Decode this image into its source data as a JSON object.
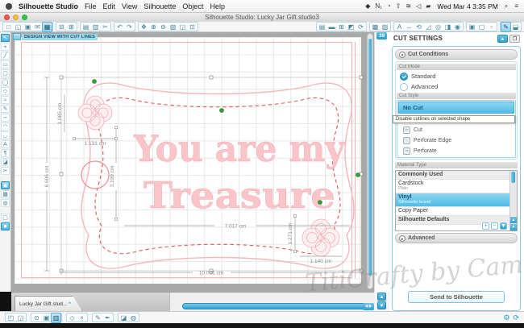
{
  "menubar": {
    "app": "Silhouette Studio",
    "items": [
      {
        "name": "menu-file",
        "label": "File"
      },
      {
        "name": "menu-edit",
        "label": "Edit"
      },
      {
        "name": "menu-view",
        "label": "View"
      },
      {
        "name": "menu-silhouette",
        "label": "Silhouette"
      },
      {
        "name": "menu-object",
        "label": "Object"
      },
      {
        "name": "menu-help",
        "label": "Help"
      }
    ],
    "status_icons": [
      {
        "name": "dropbox-icon",
        "glyph": "◆"
      },
      {
        "name": "notification-icon",
        "glyph": "N₁"
      },
      {
        "name": "progress-icon",
        "glyph": "◔"
      },
      {
        "name": "update-icon",
        "glyph": "⇧"
      },
      {
        "name": "wifi-icon",
        "glyph": "≋"
      },
      {
        "name": "volume-icon",
        "glyph": "◁"
      },
      {
        "name": "battery-icon",
        "glyph": "▰"
      }
    ],
    "clock": "Wed Mar 4 3:35 PM",
    "search_glyph": "⌕",
    "spotlight_glyph": "≡"
  },
  "titlebar": {
    "title": "Silhouette Studio: Lucky Jar Gift.studio3"
  },
  "toolbar_top": {
    "file_group": [
      {
        "name": "new-document-icon",
        "glyph": "□"
      },
      {
        "name": "open-icon",
        "glyph": "◱"
      },
      {
        "name": "save-icon",
        "glyph": "▣"
      },
      {
        "name": "save-to-library-icon",
        "glyph": "✉"
      },
      {
        "name": "save-as-icon",
        "glyph": "▦",
        "selected": true
      }
    ],
    "print_group": [
      {
        "name": "print-icon",
        "glyph": "⊟"
      },
      {
        "name": "cut-job-icon",
        "glyph": "⊞"
      }
    ],
    "clipboard_group": [
      {
        "name": "paste-icon",
        "glyph": "▤"
      },
      {
        "name": "copy-icon",
        "glyph": "▥"
      },
      {
        "name": "cut-icon",
        "glyph": "✂"
      }
    ],
    "undo_group": [
      {
        "name": "undo-icon",
        "glyph": "↶"
      },
      {
        "name": "redo-icon",
        "glyph": "↷"
      }
    ],
    "zoom_group": [
      {
        "name": "pan-icon",
        "glyph": "❖"
      },
      {
        "name": "zoom-in-icon",
        "glyph": "⊕"
      },
      {
        "name": "zoom-out-icon",
        "glyph": "⊖"
      },
      {
        "name": "drag-zoom-icon",
        "glyph": "▧"
      },
      {
        "name": "zoom-selection-icon",
        "glyph": "◲"
      },
      {
        "name": "fit-page-icon",
        "glyph": "⊡"
      }
    ],
    "document_group": [
      {
        "name": "page-settings-icon",
        "glyph": "▤"
      },
      {
        "name": "ruler-icon",
        "glyph": "▬"
      },
      {
        "name": "grid-settings-icon",
        "glyph": "⊞"
      },
      {
        "name": "registration-marks-icon",
        "glyph": "◩"
      },
      {
        "name": "rotate-view-icon",
        "glyph": "⟳"
      }
    ],
    "color_group": [
      {
        "name": "fill-color-icon",
        "glyph": "▩"
      },
      {
        "name": "line-style-icon",
        "glyph": "▨"
      }
    ],
    "object_group": [
      {
        "name": "text-style-icon",
        "glyph": "A"
      },
      {
        "name": "move-icon",
        "glyph": "↔"
      },
      {
        "name": "rotate-icon",
        "glyph": "⟲"
      },
      {
        "name": "scale-icon",
        "glyph": "◿"
      },
      {
        "name": "offset-icon",
        "glyph": "◎"
      },
      {
        "name": "mirror-icon",
        "glyph": "◨"
      },
      {
        "name": "modify-icon",
        "glyph": "◉"
      }
    ],
    "window_group": [
      {
        "name": "library-window-icon",
        "glyph": "▣"
      },
      {
        "name": "store-window-icon",
        "glyph": "▢"
      },
      {
        "name": "panels-icon",
        "glyph": "▫"
      }
    ],
    "right_group": [
      {
        "name": "cut-settings-icon",
        "glyph": "✎",
        "selected": true
      },
      {
        "name": "display-settings-icon",
        "glyph": "⬓"
      }
    ]
  },
  "left_tools": [
    {
      "name": "select-tool",
      "glyph": "↖",
      "selected": true
    },
    {
      "name": "edit-points-tool",
      "glyph": "⌖"
    },
    {
      "name": "line-tool",
      "glyph": "╱"
    },
    {
      "name": "rectangle-tool",
      "glyph": "▭"
    },
    {
      "name": "rounded-rectangle-tool",
      "glyph": "▢"
    },
    {
      "name": "ellipse-tool",
      "glyph": "◯"
    },
    {
      "name": "polygon-tool",
      "glyph": "◇"
    },
    {
      "name": "curve-tool",
      "glyph": "≈"
    },
    {
      "name": "freehand-tool",
      "glyph": "✎"
    },
    {
      "name": "smooth-freehand-tool",
      "glyph": "∽"
    },
    {
      "name": "arc-tool",
      "glyph": "◠"
    },
    {
      "name": "flexishape-tool",
      "glyph": "◡"
    },
    {
      "name": "text-tool",
      "glyph": "A"
    },
    {
      "name": "notes-tool",
      "glyph": "¶"
    },
    {
      "name": "eraser-tool",
      "glyph": "◪"
    },
    {
      "name": "knife-tool",
      "glyph": "✂"
    },
    {
      "name": "page-tool",
      "glyph": "▣",
      "selected": true,
      "kind": "gap"
    },
    {
      "name": "mat-tool",
      "glyph": "▦"
    },
    {
      "name": "simulation-tool",
      "glyph": "◍"
    },
    {
      "name": "white-swatch-tool",
      "glyph": "▢",
      "kind": "gap"
    },
    {
      "name": "blue-swatch-tool",
      "glyph": "■",
      "selected": true
    }
  ],
  "canvas": {
    "view_label": "DESIGN VIEW WITH CUT LINES",
    "page_badge": "39"
  },
  "design": {
    "line1": "You are my",
    "line2": "Treasure",
    "dims": {
      "frame_width": "10.001 cm",
      "frame_height": "6.606 cm",
      "text_width": "7.017 cm",
      "text_height": "3.199 cm",
      "flower_tl_width": "1.131 cm",
      "flower_tl_height": "1.085 cm",
      "flower_br_width": "1.140 cm",
      "flower_br_height": "1.271 cm"
    }
  },
  "cut_settings": {
    "title": "CUT SETTINGS",
    "collapse_glyph": "▲",
    "detach_glyph": "❐",
    "cut_conditions_label": "Cut Conditions",
    "cut_mode_label": "Cut Mode",
    "cut_modes": [
      {
        "name": "cut-mode-standard",
        "label": "Standard",
        "selected": true
      },
      {
        "name": "cut-mode-advanced",
        "label": "Advanced"
      }
    ],
    "cut_style_label": "Cut Style",
    "no_cut_label": "No Cut",
    "tooltip": "Disable cutlines on selected shape",
    "cut_styles": [
      {
        "name": "cut-style-cut",
        "label": "Cut",
        "icon": "✂"
      },
      {
        "name": "cut-style-perforate-edge",
        "label": "Perforate Edge",
        "icon": "┄"
      },
      {
        "name": "cut-style-perforate",
        "label": "Perforate",
        "icon": "╍"
      }
    ],
    "material_type_label": "Material Type",
    "materials": [
      {
        "name": "material-commonly-used",
        "label": "Commonly Used",
        "sub": "",
        "kind": "group"
      },
      {
        "name": "material-cardstock",
        "label": "Cardstock",
        "sub": "Plain"
      },
      {
        "name": "material-vinyl",
        "label": "Vinyl",
        "sub": "Silhouette brand",
        "selected": true
      },
      {
        "name": "material-copy-paper",
        "label": "Copy Paper",
        "sub": ""
      },
      {
        "name": "material-silhouette-defaults",
        "label": "Silhouette Defaults",
        "sub": "",
        "kind": "group"
      }
    ],
    "add_glyph": "+",
    "remove_glyph": "−",
    "dropdown_glyph": "▼",
    "advanced_label": "Advanced",
    "send_button": "Send to Silhouette"
  },
  "bottom_toolbar": {
    "arrange_group": [
      {
        "name": "bring-forward-icon",
        "glyph": "◰"
      },
      {
        "name": "send-backward-icon",
        "glyph": "◲"
      }
    ],
    "group_group": [
      {
        "name": "zoom-selected-icon",
        "glyph": "⊙"
      },
      {
        "name": "group-icon",
        "glyph": "▣"
      },
      {
        "name": "duplicate-icon",
        "glyph": "▥",
        "selected": true
      }
    ],
    "edit_group": [
      {
        "name": "shape-icon",
        "glyph": "◇"
      },
      {
        "name": "delete-icon",
        "glyph": "×"
      }
    ],
    "draw_group": [
      {
        "name": "pen-icon",
        "glyph": "✎"
      },
      {
        "name": "pen-alt-icon",
        "glyph": "✒"
      }
    ],
    "misc_group": [
      {
        "name": "eraser-small-icon",
        "glyph": "◪"
      },
      {
        "name": "fill-small-icon",
        "glyph": "◍"
      }
    ],
    "gear_glyph": "⚙",
    "sync_glyph": "⟳"
  },
  "glyphs": {
    "up": "▲",
    "down": "▼",
    "left": "◀ ▶",
    "chev_down": "▾",
    "chev_right": "▸",
    "close": "×"
  },
  "tab": {
    "label": "Lucky Jar Gift.stud...",
    "modified": "*"
  },
  "watermark": "TitiCrafty by Camila",
  "colors": {
    "accent": "#2fa9d8",
    "selection_blue": "#4fbce6",
    "design_pink": "#f9c5c9",
    "dash_red": "#e05c5c",
    "green_node": "#33a133"
  }
}
